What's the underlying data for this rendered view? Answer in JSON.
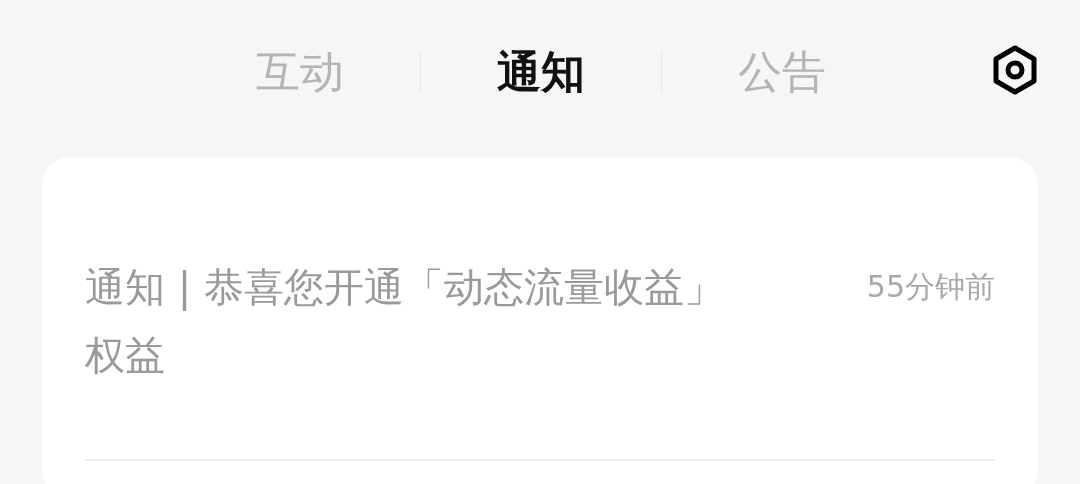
{
  "tabs": [
    {
      "label": "互动",
      "selected": false
    },
    {
      "label": "通知",
      "selected": true
    },
    {
      "label": "公告",
      "selected": false
    }
  ],
  "notifications": [
    {
      "title": "通知 | 恭喜您开通「动态流量收益」权益",
      "time": "55分钟前"
    }
  ]
}
